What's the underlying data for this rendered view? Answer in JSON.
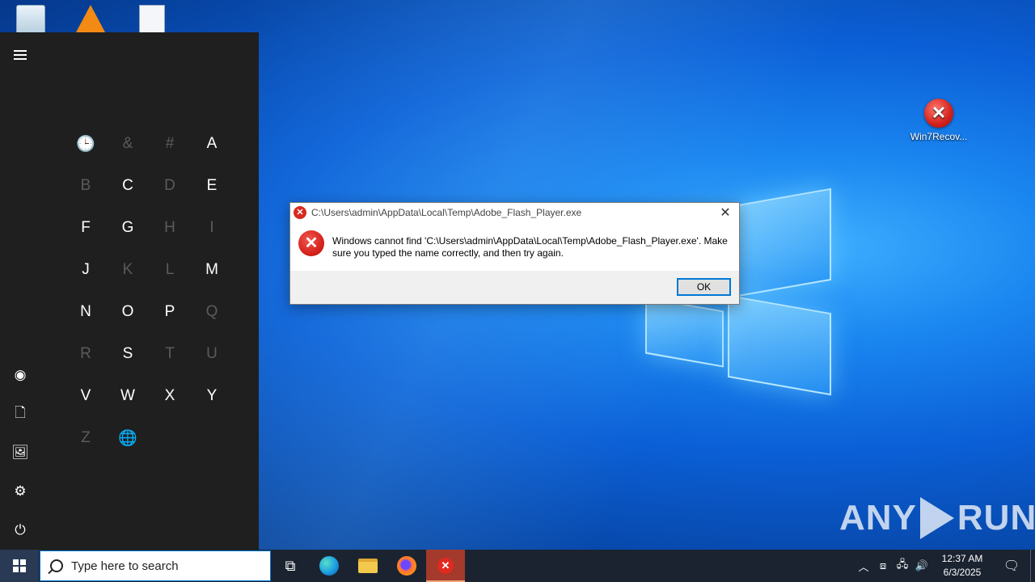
{
  "desktop": {
    "icons": [
      {
        "label": ""
      },
      {
        "label": ""
      },
      {
        "label": ""
      },
      {
        "label": "Win7Recov..."
      }
    ]
  },
  "start_menu": {
    "letters": [
      {
        "char": "🕒",
        "enabled": false
      },
      {
        "char": "&",
        "enabled": false
      },
      {
        "char": "#",
        "enabled": false
      },
      {
        "char": "A",
        "enabled": true
      },
      {
        "char": "B",
        "enabled": false
      },
      {
        "char": "C",
        "enabled": true
      },
      {
        "char": "D",
        "enabled": false
      },
      {
        "char": "E",
        "enabled": true
      },
      {
        "char": "F",
        "enabled": true
      },
      {
        "char": "G",
        "enabled": true
      },
      {
        "char": "H",
        "enabled": false
      },
      {
        "char": "I",
        "enabled": false
      },
      {
        "char": "J",
        "enabled": true
      },
      {
        "char": "K",
        "enabled": false
      },
      {
        "char": "L",
        "enabled": false
      },
      {
        "char": "M",
        "enabled": true
      },
      {
        "char": "N",
        "enabled": true
      },
      {
        "char": "O",
        "enabled": true
      },
      {
        "char": "P",
        "enabled": true
      },
      {
        "char": "Q",
        "enabled": false
      },
      {
        "char": "R",
        "enabled": false
      },
      {
        "char": "S",
        "enabled": true
      },
      {
        "char": "T",
        "enabled": false
      },
      {
        "char": "U",
        "enabled": false
      },
      {
        "char": "V",
        "enabled": true
      },
      {
        "char": "W",
        "enabled": true
      },
      {
        "char": "X",
        "enabled": true
      },
      {
        "char": "Y",
        "enabled": true
      },
      {
        "char": "Z",
        "enabled": false
      },
      {
        "char": "🌐",
        "enabled": false
      }
    ],
    "rail_icons": [
      "menu-icon",
      "user-icon",
      "documents-icon",
      "pictures-icon",
      "settings-icon",
      "power-icon"
    ]
  },
  "dialog": {
    "title": "C:\\Users\\admin\\AppData\\Local\\Temp\\Adobe_Flash_Player.exe",
    "message_line1": "Windows cannot find 'C:\\Users\\admin\\AppData\\Local\\Temp\\Adobe_Flash_Player.exe'. Make",
    "message_line2": "sure you typed the name correctly, and then try again.",
    "ok_label": "OK",
    "close_glyph": "✕"
  },
  "watermark": {
    "left": "ANY",
    "right": "RUN"
  },
  "taskbar": {
    "search_placeholder": "Type here to search",
    "apps": [
      "task-view",
      "edge",
      "file-explorer",
      "firefox",
      "error-app"
    ],
    "clock_time": "12:37 AM",
    "clock_date": "6/3/2025"
  },
  "colors": {
    "accent": "#0078d7",
    "error_red": "#d3201a",
    "start_bg": "#1f1f1f",
    "taskbar_bg": "#1b2330"
  }
}
